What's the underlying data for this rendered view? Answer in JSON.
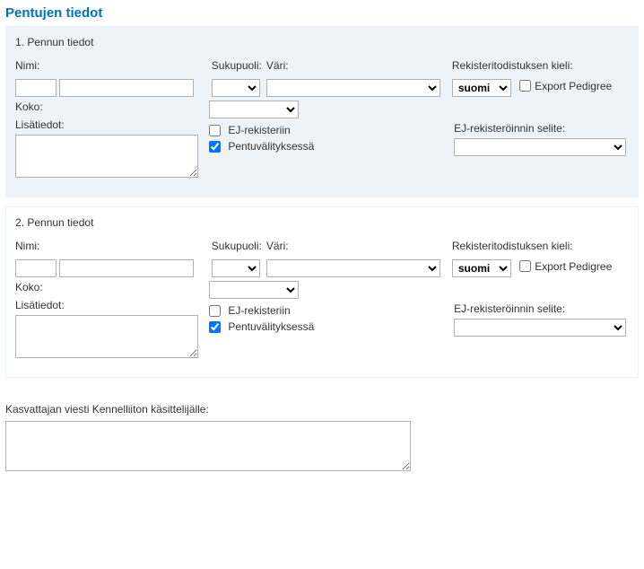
{
  "page": {
    "title": "Pentujen tiedot"
  },
  "labels": {
    "name": "Nimi:",
    "gender": "Sukupuoli:",
    "color": "Väri:",
    "lang": "Rekisteritodistuksen kieli:",
    "size": "Koko:",
    "extra": "Lisätiedot:",
    "ej_register": "EJ-rekisteriin",
    "pentuval": "Pentuvälityksessä",
    "ej_explain": "EJ-rekisteröinnin selite:",
    "export_pedigree": "Export Pedigree",
    "message": "Kasvattajan viesti Kennelliiton käsittelijälle:"
  },
  "puppies": [
    {
      "title": "1. Pennun tiedot",
      "name_prefix": "",
      "name": "",
      "gender": "",
      "color": "",
      "lang": "suomi",
      "export_pedigree": false,
      "size": "",
      "extra": "",
      "ej_register": false,
      "pentuval": true,
      "ej_explain": "",
      "highlight": true
    },
    {
      "title": "2. Pennun tiedot",
      "name_prefix": "",
      "name": "",
      "gender": "",
      "color": "",
      "lang": "suomi",
      "export_pedigree": false,
      "size": "",
      "extra": "",
      "ej_register": false,
      "pentuval": true,
      "ej_explain": "",
      "highlight": false
    }
  ],
  "message": ""
}
